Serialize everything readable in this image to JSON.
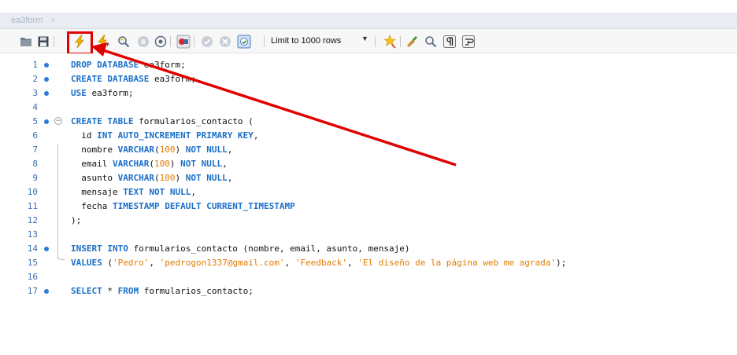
{
  "tab": {
    "title": "ea3form",
    "close_glyph": "×"
  },
  "toolbar": {
    "limit_label": "Limit to 1000 rows",
    "icons": [
      "folder-open-icon",
      "save-icon",
      "execute-icon",
      "execute-current-icon",
      "explain-icon",
      "stop-icon",
      "toggle-continue-icon",
      "commit-icon",
      "rollback-icon",
      "autocommit-icon",
      "dropdown-arrow-icon",
      "beautify-icon",
      "find-icon",
      "invisible-chars-icon",
      "word-wrap-icon"
    ]
  },
  "colors": {
    "keyword": "#1b6fc8",
    "number_string": "#e07b00",
    "line_number": "#3b6fb0",
    "highlight": "#e00000"
  },
  "editor": {
    "lines": [
      {
        "n": "1",
        "dot": true,
        "tokens": [
          [
            "kw",
            "DROP DATABASE"
          ],
          [
            "plain",
            " ea3form;"
          ]
        ]
      },
      {
        "n": "2",
        "dot": true,
        "tokens": [
          [
            "kw",
            "CREATE DATABASE"
          ],
          [
            "plain",
            " ea3form;"
          ]
        ]
      },
      {
        "n": "3",
        "dot": true,
        "tokens": [
          [
            "kw",
            "USE"
          ],
          [
            "plain",
            " ea3form;"
          ]
        ]
      },
      {
        "n": "4",
        "dot": false,
        "tokens": []
      },
      {
        "n": "5",
        "dot": true,
        "fold": true,
        "tokens": [
          [
            "kw",
            "CREATE TABLE"
          ],
          [
            "plain",
            " formularios_contacto ("
          ]
        ]
      },
      {
        "n": "6",
        "dot": false,
        "tokens": [
          [
            "plain",
            "  id "
          ],
          [
            "kw",
            "INT AUTO_INCREMENT PRIMARY KEY"
          ],
          [
            "plain",
            ","
          ]
        ]
      },
      {
        "n": "7",
        "dot": false,
        "tokens": [
          [
            "plain",
            "  nombre "
          ],
          [
            "kw",
            "VARCHAR"
          ],
          [
            "plain",
            "("
          ],
          [
            "num",
            "100"
          ],
          [
            "plain",
            ") "
          ],
          [
            "kw",
            "NOT NULL"
          ],
          [
            "plain",
            ","
          ]
        ]
      },
      {
        "n": "8",
        "dot": false,
        "tokens": [
          [
            "plain",
            "  email "
          ],
          [
            "kw",
            "VARCHAR"
          ],
          [
            "plain",
            "("
          ],
          [
            "num",
            "100"
          ],
          [
            "plain",
            ") "
          ],
          [
            "kw",
            "NOT NULL"
          ],
          [
            "plain",
            ","
          ]
        ]
      },
      {
        "n": "9",
        "dot": false,
        "tokens": [
          [
            "plain",
            "  asunto "
          ],
          [
            "kw",
            "VARCHAR"
          ],
          [
            "plain",
            "("
          ],
          [
            "num",
            "100"
          ],
          [
            "plain",
            ") "
          ],
          [
            "kw",
            "NOT NULL"
          ],
          [
            "plain",
            ","
          ]
        ]
      },
      {
        "n": "10",
        "dot": false,
        "tokens": [
          [
            "plain",
            "  mensaje "
          ],
          [
            "kw",
            "TEXT NOT NULL"
          ],
          [
            "plain",
            ","
          ]
        ]
      },
      {
        "n": "11",
        "dot": false,
        "tokens": [
          [
            "plain",
            "  fecha "
          ],
          [
            "kw",
            "TIMESTAMP DEFAULT CURRENT_TIMESTAMP"
          ]
        ]
      },
      {
        "n": "12",
        "dot": false,
        "tokens": [
          [
            "plain",
            ");"
          ]
        ]
      },
      {
        "n": "13",
        "dot": false,
        "tokens": []
      },
      {
        "n": "14",
        "dot": true,
        "tokens": [
          [
            "kw",
            "INSERT INTO"
          ],
          [
            "plain",
            " formularios_contacto (nombre, email, asunto, mensaje)"
          ]
        ]
      },
      {
        "n": "15",
        "dot": false,
        "tokens": [
          [
            "kw",
            "VALUES"
          ],
          [
            "plain",
            " ("
          ],
          [
            "str",
            "'Pedro'"
          ],
          [
            "plain",
            ", "
          ],
          [
            "str",
            "'pedrogon1337@gmail.com'"
          ],
          [
            "plain",
            ", "
          ],
          [
            "str",
            "'Feedback'"
          ],
          [
            "plain",
            ", "
          ],
          [
            "str",
            "'El diseño de la página web me agrada'"
          ],
          [
            "plain",
            ");"
          ]
        ]
      },
      {
        "n": "16",
        "dot": false,
        "tokens": []
      },
      {
        "n": "17",
        "dot": true,
        "tokens": [
          [
            "kw",
            "SELECT"
          ],
          [
            "plain",
            " * "
          ],
          [
            "kw",
            "FROM"
          ],
          [
            "plain",
            " formularios_contacto;"
          ]
        ]
      }
    ]
  }
}
